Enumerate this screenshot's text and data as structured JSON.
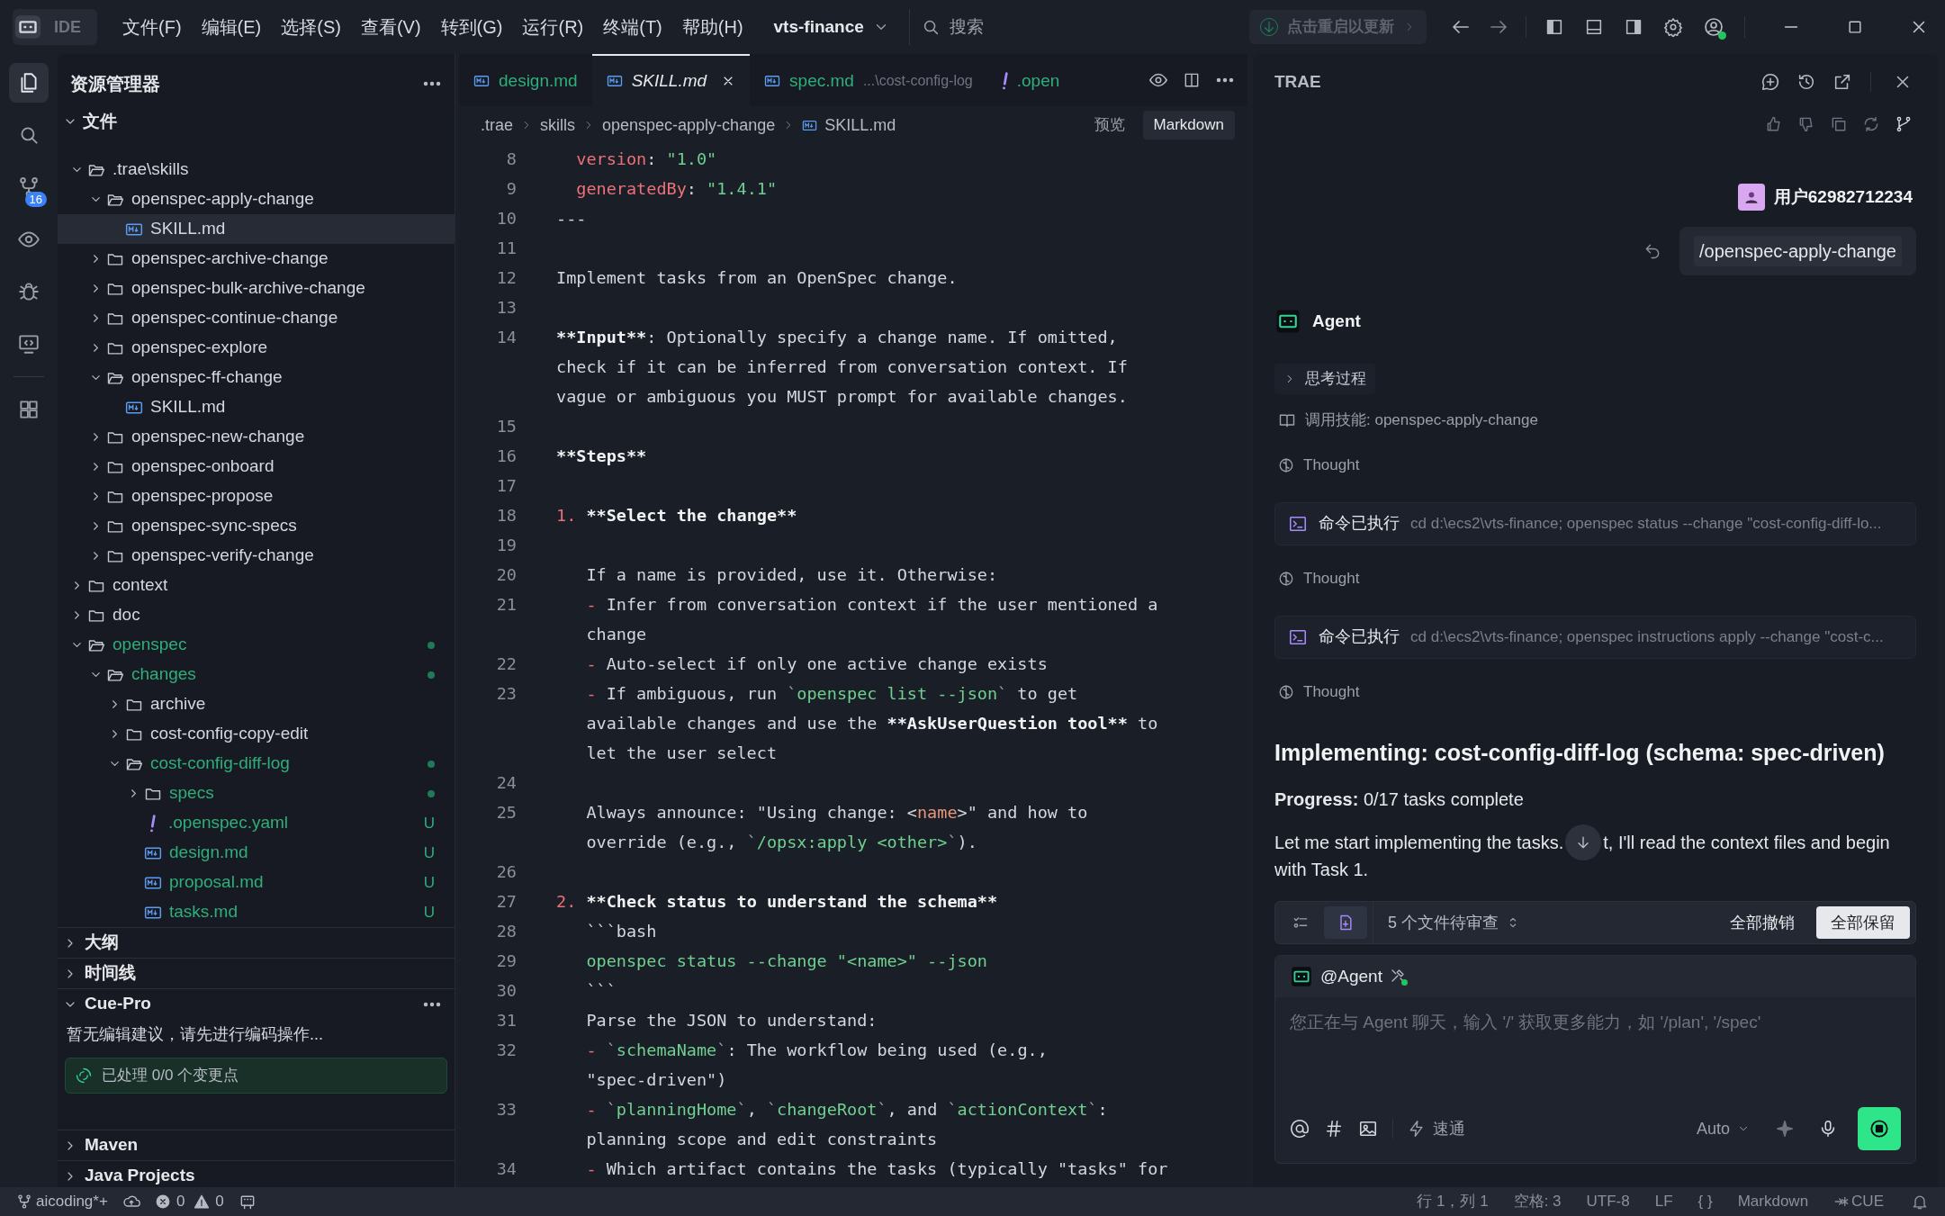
{
  "titlebar": {
    "app_label": "IDE",
    "menus": [
      "文件(F)",
      "编辑(E)",
      "选择(S)",
      "查看(V)",
      "转到(G)",
      "运行(R)",
      "终端(T)",
      "帮助(H)"
    ],
    "project": "vts-finance",
    "search": "搜索",
    "update": "点击重启以更新"
  },
  "activity_bar": [
    {
      "kind": "files",
      "selected": true
    },
    {
      "kind": "search",
      "selected": false
    },
    {
      "kind": "source-control",
      "selected": false,
      "badge": "16"
    },
    {
      "kind": "eye",
      "selected": false
    },
    {
      "kind": "bug",
      "selected": false
    },
    {
      "kind": "monitor",
      "selected": false
    },
    {
      "kind": "grid",
      "selected": false
    }
  ],
  "sidebar": {
    "title": "资源管理器",
    "section": "文件",
    "tree": [
      {
        "name": ".trae\\skills",
        "kind": "folder",
        "expanded": true,
        "selected": false,
        "untracked": false,
        "children": [
          {
            "name": "openspec-apply-change",
            "kind": "folder",
            "expanded": true,
            "selected": false,
            "untracked": false,
            "children": [
              {
                "name": "SKILL.md",
                "kind": "md",
                "selected": true,
                "untracked": false
              }
            ]
          },
          {
            "name": "openspec-archive-change",
            "kind": "folder",
            "expanded": false,
            "selected": false,
            "untracked": false
          },
          {
            "name": "openspec-bulk-archive-change",
            "kind": "folder",
            "expanded": false,
            "selected": false,
            "untracked": false
          },
          {
            "name": "openspec-continue-change",
            "kind": "folder",
            "expanded": false,
            "selected": false,
            "untracked": false
          },
          {
            "name": "openspec-explore",
            "kind": "folder",
            "expanded": false,
            "selected": false,
            "untracked": false
          },
          {
            "name": "openspec-ff-change",
            "kind": "folder",
            "expanded": true,
            "selected": false,
            "untracked": false,
            "children": [
              {
                "name": "SKILL.md",
                "kind": "md",
                "selected": false,
                "untracked": false
              }
            ]
          },
          {
            "name": "openspec-new-change",
            "kind": "folder",
            "expanded": false,
            "selected": false,
            "untracked": false
          },
          {
            "name": "openspec-onboard",
            "kind": "folder",
            "expanded": false,
            "selected": false,
            "untracked": false
          },
          {
            "name": "openspec-propose",
            "kind": "folder",
            "expanded": false,
            "selected": false,
            "untracked": false
          },
          {
            "name": "openspec-sync-specs",
            "kind": "folder",
            "expanded": false,
            "selected": false,
            "untracked": false
          },
          {
            "name": "openspec-verify-change",
            "kind": "folder",
            "expanded": false,
            "selected": false,
            "untracked": false
          }
        ]
      },
      {
        "name": "context",
        "kind": "folder",
        "expanded": false,
        "selected": false,
        "untracked": false
      },
      {
        "name": "doc",
        "kind": "folder",
        "expanded": false,
        "selected": false,
        "untracked": false
      },
      {
        "name": "openspec",
        "kind": "folder",
        "expanded": true,
        "selected": false,
        "untracked": true,
        "dot": true,
        "children": [
          {
            "name": "changes",
            "kind": "folder",
            "expanded": true,
            "selected": false,
            "untracked": true,
            "dot": true,
            "children": [
              {
                "name": "archive",
                "kind": "folder",
                "expanded": false,
                "selected": false,
                "untracked": false
              },
              {
                "name": "cost-config-copy-edit",
                "kind": "folder",
                "expanded": false,
                "selected": false,
                "untracked": false
              },
              {
                "name": "cost-config-diff-log",
                "kind": "folder",
                "expanded": true,
                "selected": false,
                "untracked": true,
                "dot": true,
                "children": [
                  {
                    "name": "specs",
                    "kind": "folder",
                    "expanded": false,
                    "selected": false,
                    "untracked": true,
                    "dot": true
                  },
                  {
                    "name": ".openspec.yaml",
                    "kind": "yaml",
                    "selected": false,
                    "untracked": true,
                    "badge": "U"
                  },
                  {
                    "name": "design.md",
                    "kind": "md",
                    "selected": false,
                    "untracked": true,
                    "badge": "U"
                  },
                  {
                    "name": "proposal.md",
                    "kind": "md",
                    "selected": false,
                    "untracked": true,
                    "badge": "U"
                  },
                  {
                    "name": "tasks.md",
                    "kind": "md",
                    "selected": false,
                    "untracked": true,
                    "badge": "U"
                  }
                ]
              }
            ]
          }
        ]
      }
    ],
    "panels": [
      {
        "title": "大纲",
        "expanded": false
      },
      {
        "title": "时间线",
        "expanded": false
      },
      {
        "title": "Cue-Pro",
        "expanded": true,
        "message": "暂无编辑建议，请先进行编码操作...",
        "status": "已处理 0/0 个变更点"
      },
      {
        "title": "Maven",
        "expanded": false
      },
      {
        "title": "Java Projects",
        "expanded": false
      }
    ]
  },
  "editor": {
    "tabs": [
      {
        "label": "design.md",
        "kind": "md",
        "selected": false,
        "untracked": true
      },
      {
        "label": "SKILL.md",
        "kind": "md",
        "selected": true,
        "untracked": false
      },
      {
        "label": "spec.md",
        "kind": "md",
        "selected": false,
        "untracked": true,
        "detail": "...\\cost-config-log"
      },
      {
        "label": ".open",
        "kind": "yaml",
        "selected": false,
        "untracked": true
      }
    ],
    "breadcrumb": [
      ".trae",
      "skills",
      "openspec-apply-change",
      "SKILL.md"
    ],
    "view_modes": [
      {
        "label": "预览",
        "selected": false
      },
      {
        "label": "Markdown",
        "selected": true
      }
    ],
    "code_lines": [
      {
        "number": "8",
        "parts": [
          {
            "kind": "key",
            "text": "  version"
          },
          {
            "kind": "plain",
            "text": ": "
          },
          {
            "kind": "string",
            "text": "\"1.0\""
          }
        ]
      },
      {
        "number": "9",
        "parts": [
          {
            "kind": "key",
            "text": "  generatedBy"
          },
          {
            "kind": "plain",
            "text": ": "
          },
          {
            "kind": "string",
            "text": "\"1.4.1\""
          }
        ]
      },
      {
        "number": "10",
        "parts": [
          {
            "kind": "plain",
            "text": "---"
          }
        ]
      },
      {
        "number": "11"
      },
      {
        "number": "12",
        "parts": [
          {
            "kind": "plain",
            "text": "Implement tasks from an OpenSpec change."
          }
        ]
      },
      {
        "number": "13"
      },
      {
        "number": "14",
        "parts": [
          {
            "kind": "bold",
            "text": "**Input**"
          },
          {
            "kind": "plain",
            "text": ": Optionally specify a change name. If omitted,"
          }
        ]
      },
      {
        "parts": [
          {
            "kind": "plain",
            "text": "check if it can be inferred from conversation context. If"
          }
        ]
      },
      {
        "parts": [
          {
            "kind": "plain",
            "text": "vague or ambiguous you MUST prompt for available changes."
          }
        ]
      },
      {
        "number": "15"
      },
      {
        "number": "16",
        "parts": [
          {
            "kind": "bold",
            "text": "**Steps**"
          }
        ]
      },
      {
        "number": "17"
      },
      {
        "number": "18",
        "parts": [
          {
            "kind": "marker",
            "text": "1. "
          },
          {
            "kind": "bold",
            "text": "**Select the change**"
          }
        ]
      },
      {
        "number": "19"
      },
      {
        "number": "20",
        "parts": [
          {
            "kind": "plain",
            "text": "   If a name is provided, use it. Otherwise:"
          }
        ]
      },
      {
        "number": "21",
        "parts": [
          {
            "kind": "marker",
            "text": "   - "
          },
          {
            "kind": "plain",
            "text": "Infer from conversation context if the user mentioned a"
          }
        ]
      },
      {
        "parts": [
          {
            "kind": "plain",
            "text": "   change"
          }
        ]
      },
      {
        "number": "22",
        "parts": [
          {
            "kind": "marker",
            "text": "   - "
          },
          {
            "kind": "plain",
            "text": "Auto-select if only one active change exists"
          }
        ]
      },
      {
        "number": "23",
        "parts": [
          {
            "kind": "marker",
            "text": "   - "
          },
          {
            "kind": "plain",
            "text": "If ambiguous, run "
          },
          {
            "kind": "tick",
            "text": "`"
          },
          {
            "kind": "code",
            "text": "openspec list --json"
          },
          {
            "kind": "tick",
            "text": "`"
          },
          {
            "kind": "plain",
            "text": " to get"
          }
        ]
      },
      {
        "parts": [
          {
            "kind": "plain",
            "text": "   available changes and use the "
          },
          {
            "kind": "bold",
            "text": "**AskUserQuestion tool**"
          },
          {
            "kind": "plain",
            "text": " to"
          }
        ]
      },
      {
        "parts": [
          {
            "kind": "plain",
            "text": "   let the user select"
          }
        ]
      },
      {
        "number": "24"
      },
      {
        "number": "25",
        "parts": [
          {
            "kind": "plain",
            "text": "   Always announce: \"Using change: <"
          },
          {
            "kind": "tag",
            "text": "name"
          },
          {
            "kind": "plain",
            "text": ">\" and how to"
          }
        ]
      },
      {
        "parts": [
          {
            "kind": "plain",
            "text": "   override (e.g., "
          },
          {
            "kind": "tick",
            "text": "`"
          },
          {
            "kind": "code",
            "text": "/opsx:apply <other>"
          },
          {
            "kind": "tick",
            "text": "`"
          },
          {
            "kind": "plain",
            "text": ")."
          }
        ]
      },
      {
        "number": "26"
      },
      {
        "number": "27",
        "parts": [
          {
            "kind": "marker",
            "text": "2. "
          },
          {
            "kind": "bold",
            "text": "**Check status to understand the schema**"
          }
        ]
      },
      {
        "number": "28",
        "parts": [
          {
            "kind": "plain",
            "text": "   ```bash"
          }
        ]
      },
      {
        "number": "29",
        "parts": [
          {
            "kind": "code",
            "text": "   openspec status --change \"<name>\" --json"
          }
        ]
      },
      {
        "number": "30",
        "parts": [
          {
            "kind": "plain",
            "text": "   ```"
          }
        ]
      },
      {
        "number": "31",
        "parts": [
          {
            "kind": "plain",
            "text": "   Parse the JSON to understand:"
          }
        ]
      },
      {
        "number": "32",
        "parts": [
          {
            "kind": "marker",
            "text": "   - "
          },
          {
            "kind": "tick",
            "text": "`"
          },
          {
            "kind": "code",
            "text": "schemaName"
          },
          {
            "kind": "tick",
            "text": "`"
          },
          {
            "kind": "plain",
            "text": ": The workflow being used (e.g.,"
          }
        ]
      },
      {
        "parts": [
          {
            "kind": "plain",
            "text": "   \"spec-driven\")"
          }
        ]
      },
      {
        "number": "33",
        "parts": [
          {
            "kind": "marker",
            "text": "   - "
          },
          {
            "kind": "tick",
            "text": "`"
          },
          {
            "kind": "code",
            "text": "planningHome"
          },
          {
            "kind": "tick",
            "text": "`"
          },
          {
            "kind": "plain",
            "text": ", "
          },
          {
            "kind": "tick",
            "text": "`"
          },
          {
            "kind": "code",
            "text": "changeRoot"
          },
          {
            "kind": "tick",
            "text": "`"
          },
          {
            "kind": "plain",
            "text": ", and "
          },
          {
            "kind": "tick",
            "text": "`"
          },
          {
            "kind": "code",
            "text": "actionContext"
          },
          {
            "kind": "tick",
            "text": "`"
          },
          {
            "kind": "plain",
            "text": ":"
          }
        ]
      },
      {
        "parts": [
          {
            "kind": "plain",
            "text": "   planning scope and edit constraints"
          }
        ]
      },
      {
        "number": "34",
        "parts": [
          {
            "kind": "marker",
            "text": "   - "
          },
          {
            "kind": "plain",
            "text": "Which artifact contains the tasks (typically \"tasks\" for"
          }
        ]
      }
    ]
  },
  "assistant": {
    "title": "TRAE",
    "user": "用户62982712234",
    "user_message": "/openspec-apply-change",
    "agent": "Agent",
    "thinking": "思考过程",
    "skill": "调用技能: openspec-apply-change",
    "steps": [
      {
        "kind": "thought",
        "text": "Thought"
      },
      {
        "kind": "command",
        "label": "命令已执行",
        "command": "cd d:\\ecs2\\vts-finance; openspec status --change \"cost-config-diff-lo..."
      },
      {
        "kind": "thought",
        "text": "Thought"
      },
      {
        "kind": "command",
        "label": "命令已执行",
        "command": "cd d:\\ecs2\\vts-finance; openspec instructions apply --change \"cost-c..."
      },
      {
        "kind": "thought",
        "text": "Thought"
      }
    ],
    "heading": "Implementing: cost-config-diff-log (schema: spec-driven)",
    "progress": "**Progress:** 0/17 tasks complete",
    "message_before": "Let me start implementing the tasks.",
    "message_after": "t, I'll read the context files and begin",
    "message_line2": "with Task 1.",
    "review": {
      "count": "5 个文件待审查",
      "discard": "全部撤销",
      "keep": "全部保留"
    },
    "input": {
      "mention": "@Agent",
      "placeholder": "您正在与 Agent 聊天，输入 '/' 获取更多能力，如 '/plan', '/spec'",
      "mode": "速通",
      "model": "Auto"
    }
  },
  "status_bar": {
    "branch": "aicoding*+",
    "errors": "0",
    "warnings": "0",
    "position": "行 1，列 1",
    "spaces": "空格: 3",
    "encoding": "UTF-8",
    "eol": "LF",
    "braces": "{ }",
    "language": "Markdown",
    "cue": "CUE"
  }
}
